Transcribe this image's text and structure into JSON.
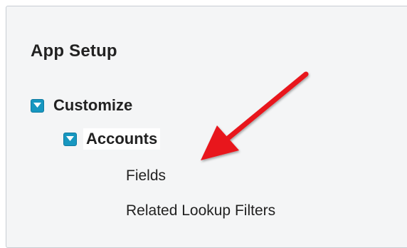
{
  "panel": {
    "title": "App Setup"
  },
  "tree": {
    "customize": {
      "label": "Customize",
      "toggle_icon": "collapse-icon",
      "expanded": true
    },
    "accounts": {
      "label": "Accounts",
      "toggle_icon": "collapse-icon",
      "expanded": true,
      "selected": true
    },
    "children": [
      {
        "label": "Fields"
      },
      {
        "label": "Related Lookup Filters"
      }
    ]
  },
  "annotation": {
    "icon": "red-arrow-icon",
    "color": "#e8141b"
  },
  "colors": {
    "toggle_bg": "#1797c0",
    "panel_bg": "#f4f5f6"
  }
}
